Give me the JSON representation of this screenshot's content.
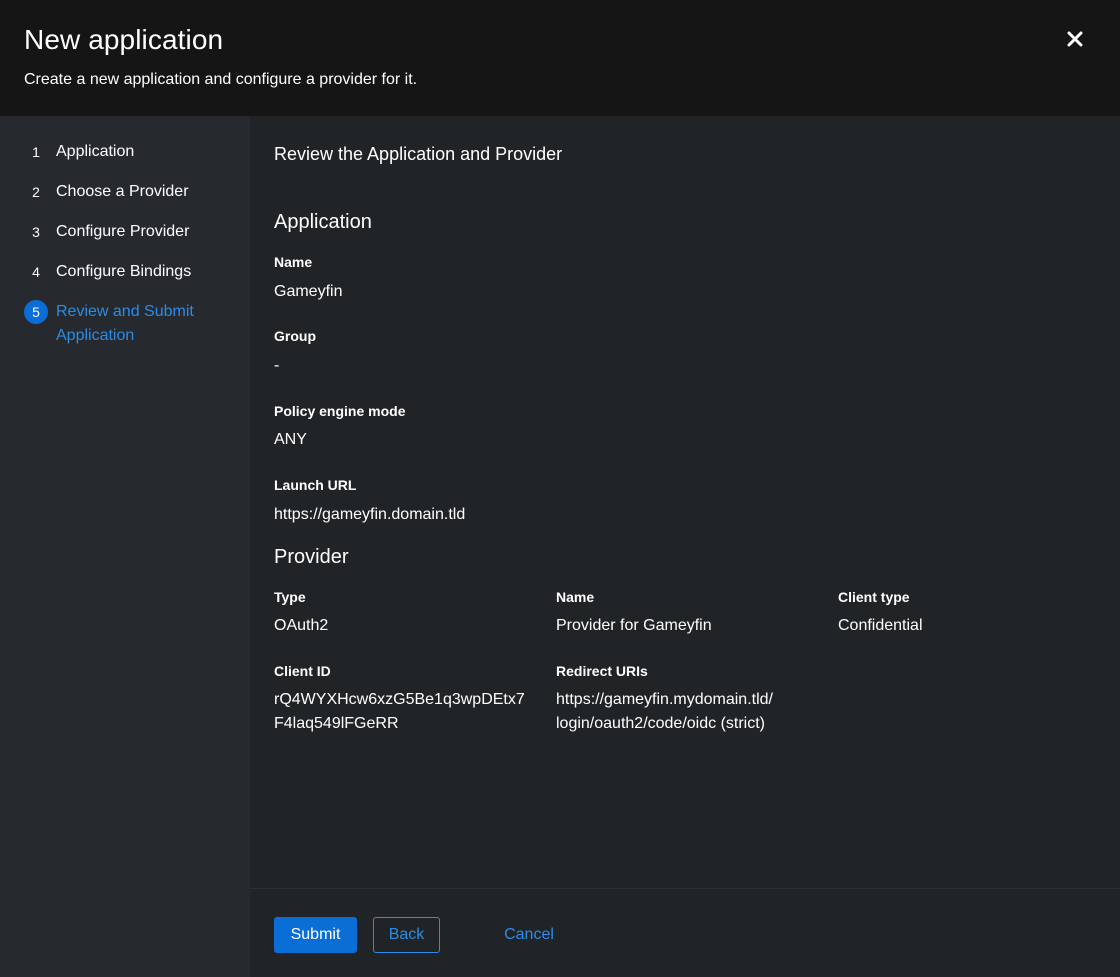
{
  "header": {
    "title": "New application",
    "description": "Create a new application and configure a provider for it."
  },
  "steps": [
    {
      "num": "1",
      "label": "Application"
    },
    {
      "num": "2",
      "label": "Choose a Provider"
    },
    {
      "num": "3",
      "label": "Configure Provider"
    },
    {
      "num": "4",
      "label": "Configure Bindings"
    },
    {
      "num": "5",
      "label": "Review and Submit Application"
    }
  ],
  "main": {
    "title": "Review the Application and Provider",
    "application": {
      "heading": "Application",
      "name_label": "Name",
      "name_value": "Gameyfin",
      "group_label": "Group",
      "group_value": "-",
      "policy_label": "Policy engine mode",
      "policy_value": "ANY",
      "launch_label": "Launch URL",
      "launch_value": "https://gameyfin.domain.tld"
    },
    "provider": {
      "heading": "Provider",
      "type_label": "Type",
      "type_value": "OAuth2",
      "name_label": "Name",
      "name_value": "Provider for Gameyfin",
      "client_type_label": "Client type",
      "client_type_value": "Confidential",
      "client_id_label": "Client ID",
      "client_id_line1": "rQ4WYXHcw6xzG5Be1q3wpDEtx7",
      "client_id_line2": "F4laq549lFGeRR",
      "redirect_label": "Redirect URIs",
      "redirect_line1": "https://gameyfin.mydomain.tld/",
      "redirect_line2": "login/oauth2/code/oidc (strict)"
    }
  },
  "footer": {
    "submit_label": "Submit",
    "back_label": "Back",
    "cancel_label": "Cancel"
  },
  "colors": {
    "accent": "#0b6ed6",
    "link": "#2b8ce8",
    "header_bg": "#151515",
    "sidebar_bg": "#26292d",
    "main_bg": "#212427"
  },
  "icons": {
    "close": "close-icon"
  }
}
